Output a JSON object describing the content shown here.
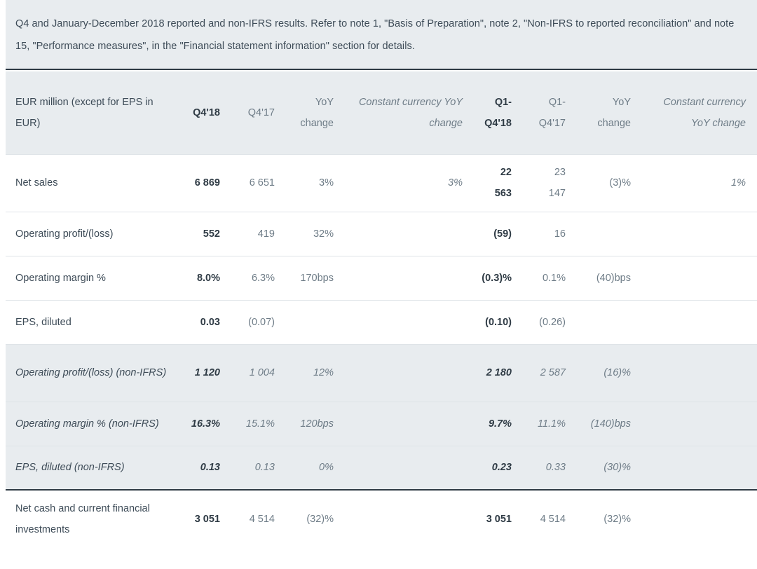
{
  "note": {
    "text": "Q4 and January-December 2018 reported and non-IFRS results. Refer to note 1, \"Basis of Preparation\", note 2, \"Non-IFRS to reported reconciliation\" and note 15, \"Performance measures\", in the \"Financial statement information\" section for details."
  },
  "table": {
    "headers": {
      "label": "EUR million (except for EPS in EUR)",
      "q4_18": "Q4'18",
      "q4_17": "Q4'17",
      "yoy_change": "YoY change",
      "cc_yoy_change": "Constant currency YoY change",
      "y_18_line1": "Q1-",
      "y_18_line2": "Q4'18",
      "y_17_line1": "Q1-",
      "y_17_line2": "Q4'17",
      "yoy_change_2": "YoY change",
      "cc_yoy_change_2": "Constant currency YoY change"
    },
    "rows": [
      {
        "label": "Net sales",
        "q4_18": "6 869",
        "q4_17": "6 651",
        "yoy": "3%",
        "cc_yoy": "3%",
        "y18_line1": "22",
        "y18_line2": "563",
        "y17_line1": "23",
        "y17_line2": "147",
        "yoy2": "(3)%",
        "cc_yoy2": "1%"
      },
      {
        "label": "Operating profit/(loss)",
        "q4_18": "552",
        "q4_17": "419",
        "yoy": "32%",
        "cc_yoy": "",
        "y18": "(59)",
        "y17": "16",
        "yoy2": "",
        "cc_yoy2": ""
      },
      {
        "label": "Operating margin %",
        "q4_18": "8.0%",
        "q4_17": "6.3%",
        "yoy": "170bps",
        "cc_yoy": "",
        "y18": "(0.3)%",
        "y17": "0.1%",
        "yoy2": "(40)bps",
        "cc_yoy2": ""
      },
      {
        "label": "EPS, diluted",
        "q4_18": "0.03",
        "q4_17": "(0.07)",
        "yoy": "",
        "cc_yoy": "",
        "y18": "(0.10)",
        "y17": "(0.26)",
        "yoy2": "",
        "cc_yoy2": ""
      },
      {
        "label": "Operating profit/(loss) (non-IFRS)",
        "q4_18": "1 120",
        "q4_17": "1 004",
        "yoy": "12%",
        "cc_yoy": "",
        "y18": "2 180",
        "y17": "2 587",
        "yoy2": "(16)%",
        "cc_yoy2": ""
      },
      {
        "label": "Operating margin % (non-IFRS)",
        "q4_18": "16.3%",
        "q4_17": "15.1%",
        "yoy": "120bps",
        "cc_yoy": "",
        "y18": "9.7%",
        "y17": "11.1%",
        "yoy2": "(140)bps",
        "cc_yoy2": ""
      },
      {
        "label": "EPS, diluted (non-IFRS)",
        "q4_18": "0.13",
        "q4_17": "0.13",
        "yoy": "0%",
        "cc_yoy": "",
        "y18": "0.23",
        "y17": "0.33",
        "yoy2": "(30)%",
        "cc_yoy2": ""
      },
      {
        "label": "Net cash and current financial investments",
        "q4_18": "3 051",
        "q4_17": "4 514",
        "yoy": "(32)%",
        "cc_yoy": "",
        "y18": "3 051",
        "y17": "4 514",
        "yoy2": "(32)%",
        "cc_yoy2": ""
      }
    ]
  },
  "colors": {
    "banner_bg": "#e8ecef",
    "nonifrs_bg": "#e8ecef",
    "text_dark": "#2f3b45",
    "text_body": "#3d4b57",
    "text_muted": "#6e7c87",
    "rule_strong": "#2f3b45",
    "rule_light": "#dfe4e8"
  }
}
